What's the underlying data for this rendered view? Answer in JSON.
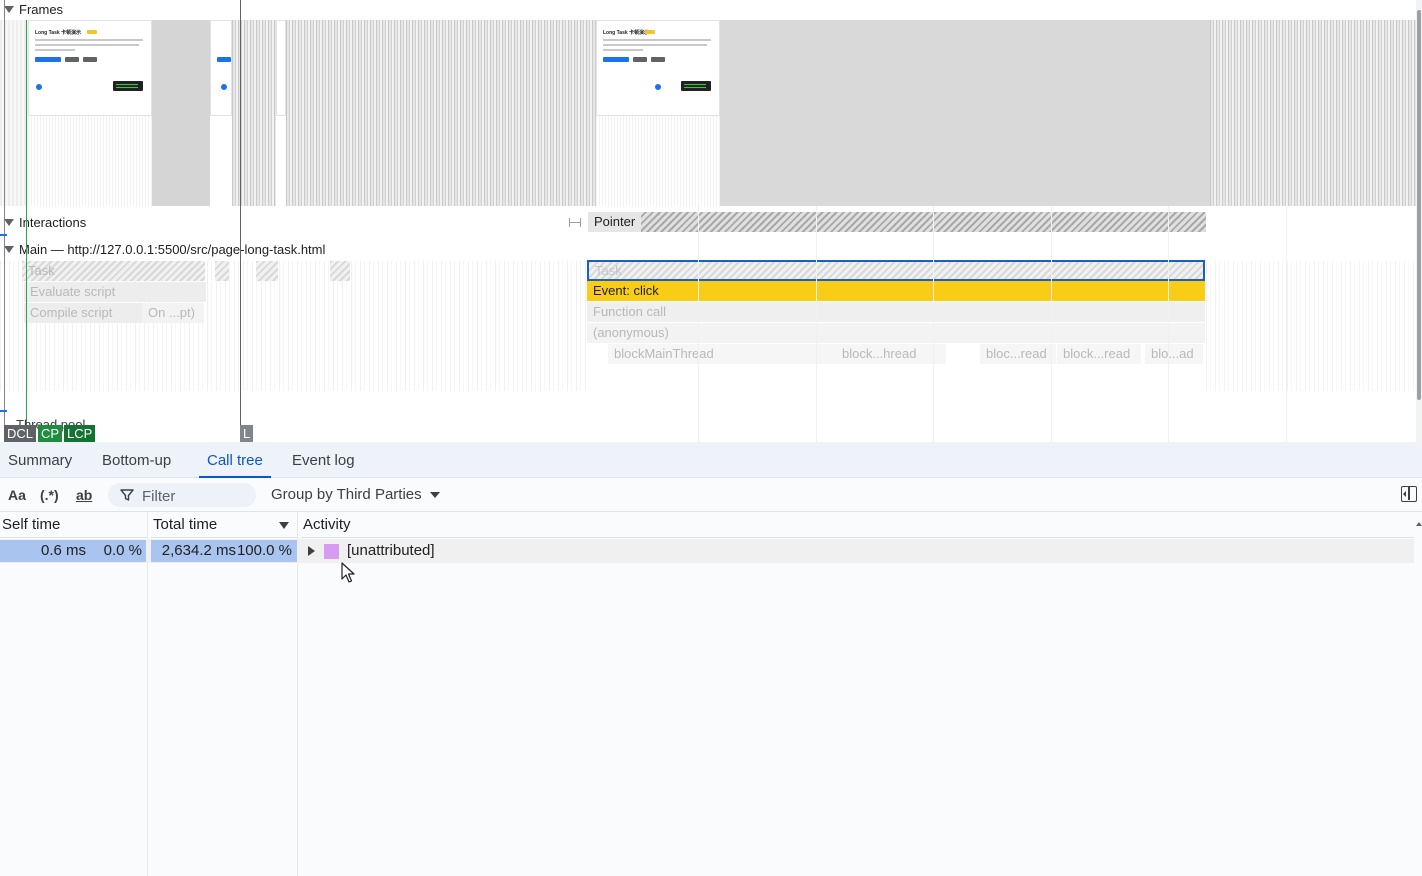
{
  "timeline": {
    "frames_label": "Frames",
    "interactions_label": "Interactions",
    "pointer_label": "Pointer",
    "main_label": "Main — http://127.0.0.1:5500/src/page-long-task.html",
    "thread_pool_label": "Thread pool",
    "thumbnail": {
      "title": "Long Task 卡顿演示"
    },
    "left_flames": {
      "task": "Task",
      "evaluate_script": "Evaluate script",
      "compile_script": "Compile script",
      "on_pt": "On ...pt)"
    },
    "right_flames": {
      "task": "Task",
      "event_click": "Event: click",
      "function_call": "Function call",
      "anonymous": "(anonymous)",
      "block1": "blockMainThread",
      "block2": "block...hread",
      "block3": "bloc...read",
      "block4": "block...read",
      "block5": "blo...ad"
    },
    "markers": {
      "dcl": "DCL",
      "cp": "CP",
      "lcp": "LCP",
      "l": "L"
    }
  },
  "tabs": [
    "Summary",
    "Bottom-up",
    "Call tree",
    "Event log"
  ],
  "active_tab": "Call tree",
  "toolbar": {
    "match_case": "Aa",
    "regex": "(.*)",
    "whole_word": "ab",
    "filter_placeholder": "Filter",
    "group_by": "Group by Third Parties"
  },
  "table": {
    "columns": {
      "self_time": "Self time",
      "total_time": "Total time",
      "activity": "Activity"
    },
    "rows": [
      {
        "self_ms": "0.6 ms",
        "self_pct": "0.0 %",
        "total_ms": "2,634.2 ms",
        "total_pct": "100.0 %",
        "activity": "[unattributed]"
      }
    ]
  },
  "colors": {
    "accent": "#0b57d0",
    "event_click": "#f9cc16",
    "task_selected_border": "#1a5fc4",
    "activity_swatch": "#d69cf0",
    "selected_cell": "#a9c4ee",
    "dcl_marker": "#5f6368",
    "lcp_marker": "#137333"
  }
}
